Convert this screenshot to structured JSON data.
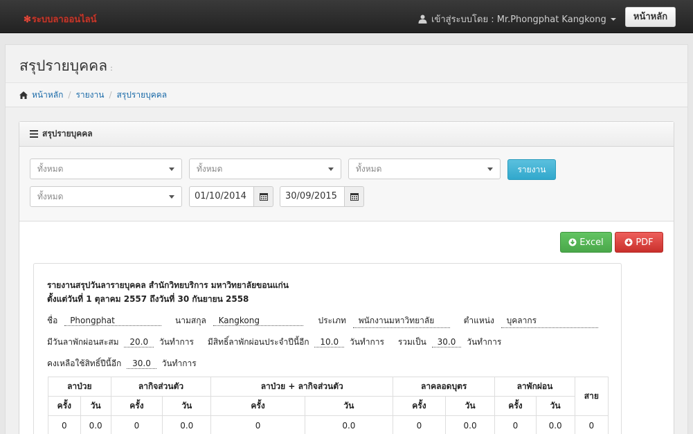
{
  "navbar": {
    "brand": "ระบบลาออนไลน์",
    "user_label": "เข้าสู่ระบบโดย : Mr.Phongphat Kangkong",
    "home_button": "หน้าหลัก"
  },
  "page": {
    "title": "สรุปรายบุคคล",
    "title_suffix": ":"
  },
  "breadcrumb": [
    "หน้าหลัก",
    "รายงาน",
    "สรุปรายบุคคล"
  ],
  "panel": {
    "heading": "สรุปรายบุคคล"
  },
  "filters": {
    "select1": "ทั้งหมด",
    "select2": "ทั้งหมด",
    "select3": "ทั้งหมด",
    "select4": "ทั้งหมด",
    "report_button": "รายงาน",
    "date_from": "01/10/2014",
    "date_to": "30/09/2015"
  },
  "export": {
    "excel": "Excel",
    "pdf": "PDF"
  },
  "report": {
    "title": "รายงานสรุปวันลารายบุคคล สำนักวิทยบริการ มหาวิทยาลัยขอนแก่น",
    "subtitle": "ตั้งแต่วันที่ 1 ตุลาคม 2557 ถึงวันที่ 30 กันยายน 2558",
    "first_name_label": "ชื่อ",
    "first_name": "Phongphat",
    "last_name_label": "นามสกุล",
    "last_name": "Kangkong",
    "type_label": "ประเภท",
    "type": "พนักงานมหาวิทยาลัย",
    "position_label": "ตำแหน่ง",
    "position": "บุคลากร",
    "accum_label": "มีวันลาพักผ่อนสะสม",
    "accum": "20.0",
    "days_unit": "วันทำการ",
    "entitled_label": "มีสิทธิ์ลาพักผ่อนประจำปีนี้อีก",
    "entitled": "10.0",
    "total_label": "รวมเป็น",
    "total": "30.0",
    "remaining_label": "คงเหลือใช้สิทธิ์ปีนี้อีก",
    "remaining": "30.0"
  },
  "table": {
    "groups": [
      "ลาป่วย",
      "ลากิจส่วนตัว",
      "ลาป่วย + ลากิจส่วนตัว",
      "ลาคลอดบุตร",
      "ลาพักผ่อน"
    ],
    "last_col": "สาย",
    "sub_times": "ครั้ง",
    "sub_days": "วัน",
    "row": [
      "0",
      "0.0",
      "0",
      "0.0",
      "0",
      "0.0",
      "0",
      "0.0",
      "0",
      "0.0",
      "0"
    ]
  }
}
